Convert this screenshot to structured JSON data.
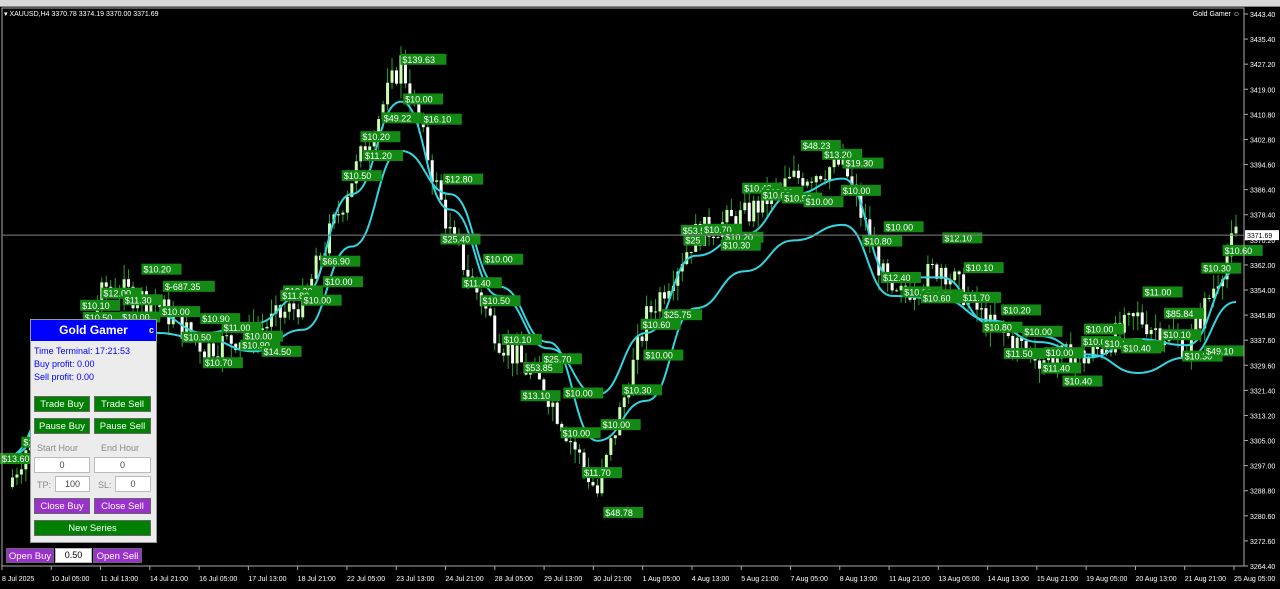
{
  "header": {
    "symbol": "▾ XAUUSD,H4  3370.78 3374.19 3370.00 3371.69",
    "brand": "Gold Gamer"
  },
  "colors": {
    "ema": "#33d6e0",
    "bull": "#c8ffb0",
    "bear": "#ffffff",
    "label_bg": "#138a13",
    "price_line": "#808080"
  },
  "price_axis": {
    "ticks": [
      "3443.40",
      "3435.40",
      "3427.20",
      "3419.00",
      "3410.80",
      "3402.80",
      "3394.60",
      "3386.40",
      "3378.40",
      "3370.20",
      "3362.00",
      "3354.00",
      "3345.80",
      "3337.60",
      "3329.60",
      "3321.40",
      "3313.20",
      "3305.00",
      "3297.00",
      "3288.80",
      "3280.60",
      "3272.60",
      "3264.40"
    ],
    "current": "3371.69"
  },
  "time_axis": {
    "ticks": [
      "8 Jul 2025",
      "10 Jul 05:00",
      "11 Jul 13:00",
      "14 Jul 21:00",
      "16 Jul 05:00",
      "17 Jul 13:00",
      "18 Jul 21:00",
      "22 Jul 05:00",
      "23 Jul 13:00",
      "24 Jul 21:00",
      "28 Jul 05:00",
      "29 Jul 13:00",
      "30 Jul 21:00",
      "1 Aug 05:00",
      "4 Aug 13:00",
      "5 Aug 21:00",
      "7 Aug 05:00",
      "8 Aug 13:00",
      "11 Aug 21:00",
      "13 Aug 05:00",
      "14 Aug 13:00",
      "15 Aug 21:00",
      "19 Aug 05:00",
      "20 Aug 13:00",
      "21 Aug 21:00",
      "25 Aug 05:00"
    ]
  },
  "trade_labels": [
    "$13.60",
    "$10.60",
    "$13.10",
    "$10.00",
    "$10.30",
    "$10.50",
    "$10.10",
    "$12.00",
    "$11.30",
    "$10.00",
    "$10.20",
    "$-687.35",
    "$10.00",
    "$10.50",
    "$10.70",
    "$10.90",
    "$11.00",
    "$10.00",
    "$10.90",
    "$14.50",
    "$10.20",
    "$11.80",
    "$10.00",
    "$10.00",
    "$66.90",
    "$10.50",
    "$11.20",
    "$10.20",
    "$49.22",
    "$10.00",
    "$139.63",
    "$16.10",
    "$12.80",
    "$25.40",
    "$11.40",
    "$10.00",
    "$10.50",
    "$10.10",
    "$53.85",
    "$13.10",
    "$25.70",
    "$10.00",
    "$10.00",
    "$11.70",
    "$48.78",
    "$10.00",
    "$10.30",
    "$10.00",
    "$10.60",
    "$25.75",
    "$25",
    "$53.50",
    "$10.70",
    "$10.20",
    "$10.30",
    "$10.40",
    "$10.00",
    "$10.00",
    "$10.90",
    "$10.00",
    "$48.23",
    "$13.20",
    "$19.30",
    "$10.00",
    "$10.80",
    "$10.00",
    "$12.40",
    "$10.20",
    "$10.20",
    "$10.60",
    "$12.10",
    "$10.10",
    "$11.70",
    "$10.80",
    "$11.50",
    "$10.20",
    "$10.00",
    "$10.00",
    "$11.40",
    "$10.40",
    "$10.00",
    "$10.00",
    "$10.10",
    "$12.10",
    "$10.40",
    "$11.00",
    "$85.84",
    "$10.10",
    "$10.30",
    "$49.10",
    "$10.30",
    "$10.60"
  ],
  "chart_data": {
    "type": "candlestick",
    "title": "XAUUSD,H4",
    "ylim": [
      3264.4,
      3443.4
    ],
    "x": [
      "8 Jul 2025",
      "10 Jul 05:00",
      "11 Jul 13:00",
      "14 Jul 21:00",
      "16 Jul 05:00",
      "17 Jul 13:00",
      "18 Jul 21:00",
      "22 Jul 05:00",
      "23 Jul 13:00",
      "24 Jul 21:00",
      "28 Jul 05:00",
      "29 Jul 13:00",
      "30 Jul 21:00",
      "1 Aug 05:00",
      "4 Aug 13:00",
      "5 Aug 21:00",
      "7 Aug 05:00",
      "8 Aug 13:00",
      "11 Aug 21:00",
      "13 Aug 05:00",
      "14 Aug 13:00",
      "15 Aug 21:00",
      "19 Aug 05:00",
      "20 Aug 13:00",
      "21 Aug 21:00",
      "25 Aug 05:00"
    ],
    "close": [
      3290,
      3325,
      3355,
      3350,
      3335,
      3340,
      3350,
      3390,
      3428,
      3372,
      3338,
      3320,
      3288,
      3345,
      3372,
      3378,
      3390,
      3395,
      3350,
      3362,
      3342,
      3332,
      3332,
      3345,
      3335,
      3371.69
    ],
    "ema_fast": [
      3300,
      3320,
      3342,
      3346,
      3340,
      3343,
      3352,
      3385,
      3415,
      3380,
      3352,
      3335,
      3320,
      3340,
      3365,
      3372,
      3385,
      3390,
      3358,
      3358,
      3343,
      3337,
      3332,
      3338,
      3336,
      3360
    ],
    "ema_slow": [
      3300,
      3312,
      3330,
      3340,
      3338,
      3334,
      3341,
      3368,
      3399,
      3385,
      3355,
      3337,
      3305,
      3318,
      3348,
      3360,
      3370,
      3375,
      3352,
      3351,
      3344,
      3339,
      3333,
      3327,
      3332,
      3350
    ]
  },
  "panel": {
    "title": "Gold Gamer",
    "close": "c",
    "time_label": "Time Terminal:",
    "time_value": "17:21:53",
    "buy_profit": "Buy profit: 0.00",
    "sell_profit": "Sell profit: 0.00",
    "trade_buy": "Trade Buy",
    "trade_sell": "Trade Sell",
    "pause_buy": "Pause Buy",
    "pause_sell": "Pause Sell",
    "start_hour": "Start Hour",
    "end_hour": "End Hour",
    "start_val": "0",
    "end_val": "0",
    "tp_label": "TP:",
    "tp_val": "100",
    "sl_label": "SL:",
    "sl_val": "0",
    "close_buy": "Close Buy",
    "close_sell": "Close Sell",
    "new_series": "New Series"
  },
  "bottom": {
    "open_buy": "Open Buy",
    "lot": "0.50",
    "open_sell": "Open Sell"
  }
}
